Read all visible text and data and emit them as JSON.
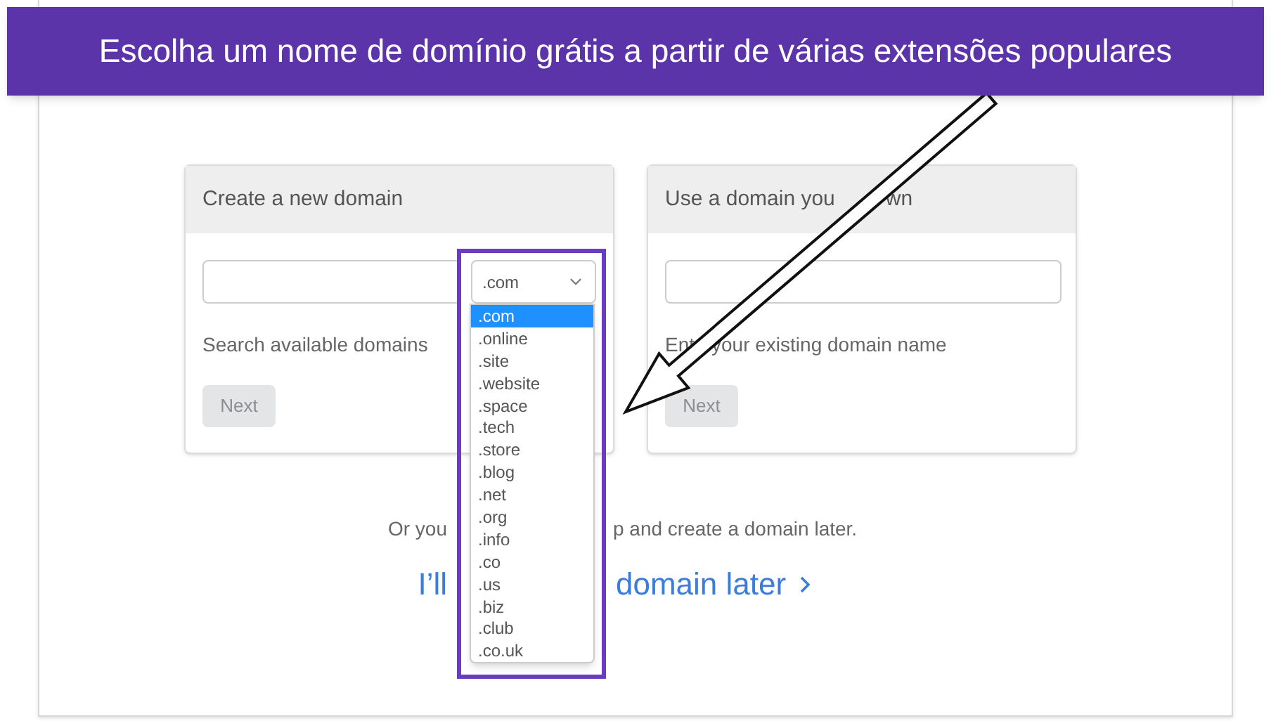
{
  "banner": {
    "text": "Escolha um nome de domínio grátis a partir de várias extensões populares"
  },
  "create_card": {
    "title": "Create a new domain",
    "tld_select": {
      "value": ".com"
    },
    "helper": "Search available domains",
    "next_button": {
      "label": "Next",
      "disabled": true
    }
  },
  "tld_options": [
    {
      "label": ".com",
      "selected": true
    },
    {
      "label": ".online",
      "selected": false
    },
    {
      "label": ".site",
      "selected": false
    },
    {
      "label": ".website",
      "selected": false
    },
    {
      "label": ".space",
      "selected": false
    },
    {
      "label": ".tech",
      "selected": false
    },
    {
      "label": ".store",
      "selected": false
    },
    {
      "label": ".blog",
      "selected": false
    },
    {
      "label": ".net",
      "selected": false
    },
    {
      "label": ".org",
      "selected": false
    },
    {
      "label": ".info",
      "selected": false
    },
    {
      "label": ".co",
      "selected": false
    },
    {
      "label": ".us",
      "selected": false
    },
    {
      "label": ".biz",
      "selected": false
    },
    {
      "label": ".club",
      "selected": false
    },
    {
      "label": ".co.uk",
      "selected": false
    }
  ],
  "own_card": {
    "title_parts": [
      "Use a domain you",
      "wn"
    ],
    "helper_parts": [
      "Ent",
      "your existing domain name"
    ],
    "next_button": {
      "label": "Next",
      "disabled": true
    }
  },
  "footer": {
    "note_parts": [
      "Or you",
      "p and create a domain later."
    ],
    "link_parts": [
      "I’ll",
      "domain later"
    ]
  }
}
